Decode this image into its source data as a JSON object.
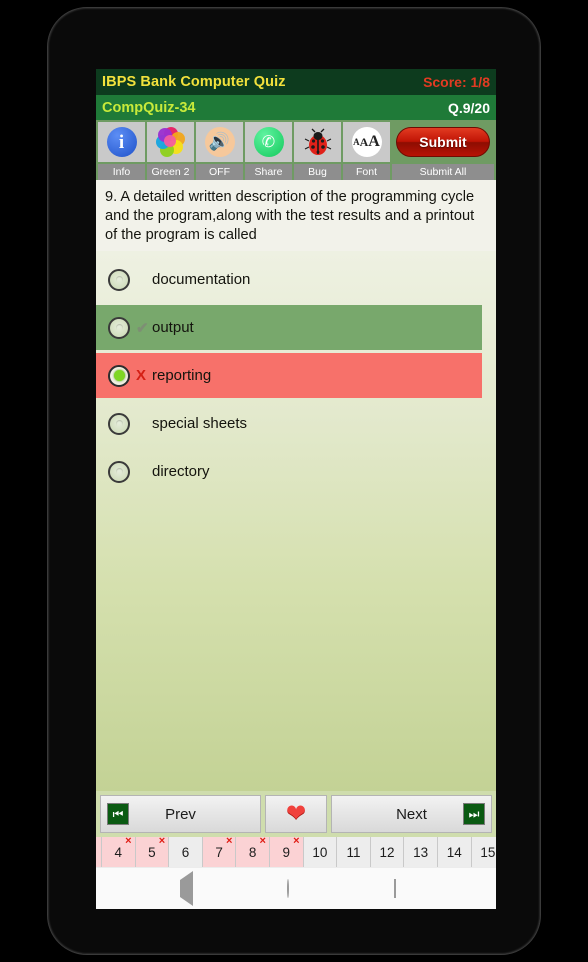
{
  "app": {
    "title": "IBPS Bank Computer Quiz",
    "score_label": "Score: 1/8",
    "quiz_id": "CompQuiz-34",
    "question_counter": "Q.9/20"
  },
  "toolbar": {
    "items": [
      {
        "icon": "info-icon",
        "label": "Info"
      },
      {
        "icon": "palette-icon",
        "label": "Green 2"
      },
      {
        "icon": "speaker-off-icon",
        "label": "OFF"
      },
      {
        "icon": "share-icon",
        "label": "Share"
      },
      {
        "icon": "bug-icon",
        "label": "Bug"
      },
      {
        "icon": "font-size-icon",
        "label": "Font"
      }
    ],
    "submit_label": "Submit",
    "submit_all_label": "Submit All"
  },
  "question": {
    "text": "9. A detailed written description of the programming cycle and the program,along with the test results and a printout of the program is called",
    "options": [
      {
        "label": "documentation",
        "state": "plain",
        "selected": false,
        "mark": ""
      },
      {
        "label": "output",
        "state": "correct",
        "selected": false,
        "mark": "✔"
      },
      {
        "label": "reporting",
        "state": "wrong",
        "selected": true,
        "mark": "X"
      },
      {
        "label": "special sheets",
        "state": "plain",
        "selected": false,
        "mark": ""
      },
      {
        "label": "directory",
        "state": "plain",
        "selected": false,
        "mark": ""
      }
    ]
  },
  "navigation": {
    "prev_label": "Prev",
    "next_label": "Next",
    "prev_icon": "skip-to-start-icon",
    "next_icon": "skip-to-end-icon",
    "favorite_icon": "heart-icon"
  },
  "question_strip": {
    "cells": [
      {
        "number": "4",
        "marked": true
      },
      {
        "number": "5",
        "marked": true
      },
      {
        "number": "6",
        "marked": false
      },
      {
        "number": "7",
        "marked": true
      },
      {
        "number": "8",
        "marked": true
      },
      {
        "number": "9",
        "marked": true
      },
      {
        "number": "10",
        "marked": false
      },
      {
        "number": "11",
        "marked": false
      },
      {
        "number": "12",
        "marked": false
      },
      {
        "number": "13",
        "marked": false
      },
      {
        "number": "14",
        "marked": false
      },
      {
        "number": "15",
        "marked": false
      }
    ],
    "wrong_mark": "×"
  },
  "system_nav": {
    "back_icon": "back-triangle-icon",
    "home_icon": "home-circle-icon",
    "recents_icon": "recents-square-icon"
  },
  "colors": {
    "title_bar": "#0d3b1e",
    "sub_bar": "#1f7a38",
    "title_text": "#f2e13c",
    "score_text": "#e23b22",
    "quiz_text": "#c8ea3a",
    "correct": "#78a86c",
    "wrong": "#f7716a",
    "selected_dot": "#7fd623",
    "submit": "#c01405"
  }
}
